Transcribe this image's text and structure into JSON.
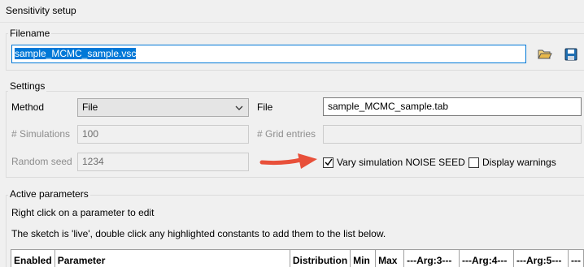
{
  "window": {
    "title": "Sensitivity setup"
  },
  "filename_group": {
    "title": "Filename",
    "input_value": "sample_MCMC_sample.vsc",
    "open_icon": "folder-open-icon",
    "save_icon": "save-disk-icon"
  },
  "settings": {
    "title": "Settings",
    "method_label": "Method",
    "method_value": "File",
    "file_label": "File",
    "file_value": "sample_MCMC_sample.tab",
    "simulations_label": "# Simulations",
    "simulations_value": "100",
    "grid_entries_label": "# Grid entries",
    "grid_entries_value": "",
    "random_seed_label": "Random seed",
    "random_seed_value": "1234",
    "vary_noise_seed_label": "Vary simulation NOISE SEED",
    "vary_noise_seed_checked": true,
    "display_warnings_label": "Display warnings",
    "display_warnings_checked": false
  },
  "active_parameters": {
    "title": "Active parameters",
    "hint_1": "Right click on a parameter to edit",
    "hint_2": "The sketch is 'live', double click any highlighted constants to add them to the list below.",
    "columns": [
      "Enabled",
      "Parameter",
      "Distribution",
      "Min",
      "Max",
      "---Arg:3---",
      "---Arg:4---",
      "---Arg:5---",
      "---"
    ]
  },
  "colors": {
    "accent": "#0078d7",
    "arrow": "#e8503a",
    "save_icon": "#1f6fb2",
    "folder_icon": "#e8b84a"
  }
}
